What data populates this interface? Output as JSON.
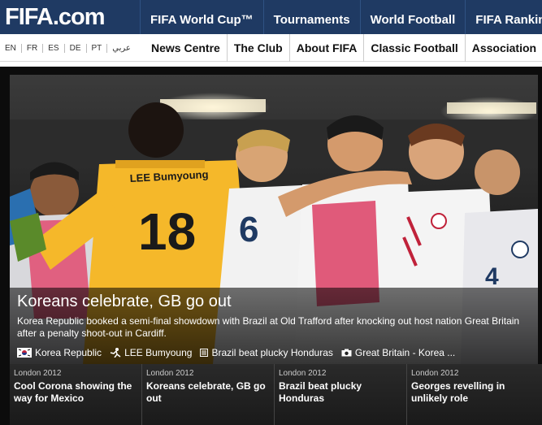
{
  "logo": {
    "text": "FIFA.com"
  },
  "top_nav": [
    "FIFA World Cup™",
    "Tournaments",
    "World Football",
    "FIFA Ranking"
  ],
  "languages": [
    "EN",
    "FR",
    "ES",
    "DE",
    "PT",
    "عربي"
  ],
  "section_nav": [
    "News Centre",
    "The Club",
    "About FIFA",
    "Classic Football",
    "Association"
  ],
  "hero": {
    "headline": "Koreans celebrate, GB go out",
    "summary": "Korea Republic booked a semi-final showdown with Brazil at Old Trafford after knocking out host nation Great Britain after a penalty shoot-out in Cardiff.",
    "jersey_name": "LEE Bumyoung",
    "jersey_number": "18",
    "tags": [
      {
        "icon": "flag-icon",
        "label": "Korea Republic"
      },
      {
        "icon": "player-icon",
        "label": "LEE Bumyoung"
      },
      {
        "icon": "article-icon",
        "label": "Brazil beat plucky Honduras"
      },
      {
        "icon": "camera-icon",
        "label": "Great Britain - Korea ..."
      }
    ]
  },
  "related": [
    {
      "kicker": "London 2012",
      "title": "Cool Corona showing the way for Mexico"
    },
    {
      "kicker": "London 2012",
      "title": "Koreans celebrate, GB go out"
    },
    {
      "kicker": "London 2012",
      "title": "Brazil beat plucky Honduras"
    },
    {
      "kicker": "London 2012",
      "title": "Georges revelling in unlikely role"
    }
  ],
  "colors": {
    "header_bg": "#1f3a63",
    "keeper_jersey": "#f5b82a",
    "korea_white": "#f4f4f4",
    "bib": "#e05a7a"
  }
}
